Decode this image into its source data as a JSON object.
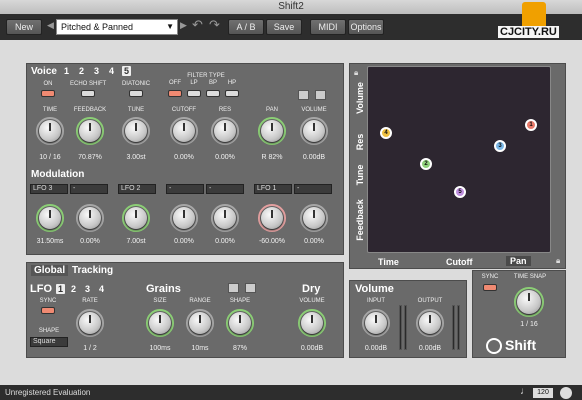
{
  "window": {
    "title": "Shift2"
  },
  "toolbar": {
    "new": "New",
    "preset": "Pitched & Panned",
    "ab": "A / B",
    "save": "Save",
    "midi": "MIDI",
    "options": "Options"
  },
  "voice": {
    "title": "Voice",
    "nums": [
      "1",
      "2",
      "3",
      "4",
      "5"
    ],
    "on": "ON",
    "echo_shift": "ECHO SHIFT",
    "diatonic": "DIATONIC",
    "filter_type": "FILTER TYPE",
    "filters": [
      "OFF",
      "LP",
      "BP",
      "HP"
    ],
    "knobs": [
      {
        "label": "TIME",
        "value": "10 / 16"
      },
      {
        "label": "FEEDBACK",
        "value": "70.87%"
      },
      {
        "label": "TUNE",
        "value": "3.00st"
      },
      {
        "label": "CUTOFF",
        "value": "0.00%"
      },
      {
        "label": "RES",
        "value": "0.00%"
      },
      {
        "label": "PAN",
        "value": "R 82%"
      },
      {
        "label": "VOLUME",
        "value": "0.00dB"
      }
    ]
  },
  "modulation": {
    "title": "Modulation",
    "selectors": [
      "LFO 3",
      "-",
      "LFO 2",
      "-",
      "-",
      "LFO 1",
      "-"
    ],
    "values": [
      "31.50ms",
      "0.00%",
      "7.00st",
      "0.00%",
      "0.00%",
      "-60.00%",
      "0.00%"
    ]
  },
  "pad": {
    "side": [
      "Volume",
      "Res",
      "Tune",
      "Feedback"
    ],
    "bottom_time": "Time",
    "bottom_cutoff": "Cutoff",
    "bottom_pan": "Pan",
    "dots": [
      "4",
      "1",
      "3",
      "2",
      "5"
    ]
  },
  "global": {
    "tab_global": "Global",
    "tab_tracking": "Tracking",
    "lfo": "LFO",
    "lfo_nums": [
      "1",
      "2",
      "3",
      "4"
    ],
    "sync": "SYNC",
    "rate": "RATE",
    "rate_value": "1 / 2",
    "shape": "SHAPE",
    "shape_value": "Square",
    "grains": "Grains",
    "grain_knobs": [
      {
        "label": "SIZE",
        "value": "100ms"
      },
      {
        "label": "RANGE",
        "value": "10ms"
      },
      {
        "label": "SHAPE",
        "value": "87%"
      }
    ],
    "dry": "Dry",
    "dry_volume": "VOLUME",
    "dry_value": "0.00dB"
  },
  "volume": {
    "title": "Volume",
    "input": "INPUT",
    "input_value": "0.00dB",
    "output": "OUTPUT",
    "output_value": "0.00dB"
  },
  "timesnap": {
    "sync": "SYNC",
    "label": "TIME SNAP",
    "value": "1 / 16"
  },
  "brand": {
    "name": "Shift"
  },
  "status": {
    "text": "Unregistered Evaluation",
    "tempo": "120"
  },
  "watermark": {
    "text": "CJCITY.RU"
  }
}
